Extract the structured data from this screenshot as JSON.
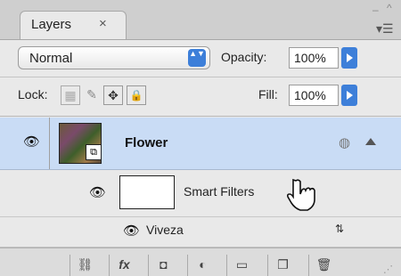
{
  "tab": {
    "title": "Layers",
    "close_glyph": "×"
  },
  "window_controls": {
    "minimize": "–",
    "collapse": "^"
  },
  "panel_menu_glyph": "▾☰",
  "blend": {
    "mode": "Normal",
    "stepper_glyph": "▲▼"
  },
  "opacity": {
    "label": "Opacity:",
    "value": "100%"
  },
  "lock": {
    "label": "Lock:",
    "icons": [
      {
        "name": "lock-transparent-pixels-icon",
        "glyph": "▦"
      },
      {
        "name": "lock-image-pixels-icon",
        "glyph": "✎"
      },
      {
        "name": "lock-position-icon",
        "glyph": "✥"
      },
      {
        "name": "lock-all-icon",
        "glyph": "🔒"
      }
    ]
  },
  "fill": {
    "label": "Fill:",
    "value": "100%"
  },
  "layers": {
    "main": {
      "name": "Flower",
      "eye_glyph": "👁",
      "smart_badge_glyph": "⧉",
      "fx_glyph": "◍"
    },
    "smart_filters": {
      "label": "Smart Filters",
      "eye_glyph": "👁"
    },
    "filter": {
      "label": "Viveza",
      "eye_glyph": "👁",
      "options_glyph": "⇅"
    }
  },
  "bottom_bar": [
    {
      "name": "link-layers-icon",
      "glyph": "⛓"
    },
    {
      "name": "fx-icon",
      "glyph": "fx"
    },
    {
      "name": "add-mask-icon",
      "glyph": "◘"
    },
    {
      "name": "adjustment-layer-icon",
      "glyph": "◐"
    },
    {
      "name": "new-group-folder-icon",
      "glyph": "▭"
    },
    {
      "name": "new-layer-icon",
      "glyph": "❐"
    },
    {
      "name": "trash-icon",
      "glyph": "🗑"
    }
  ],
  "colors": {
    "selection": "#c9dcf5",
    "accent": "#3d7fd9",
    "panel": "#e9e9e9"
  }
}
